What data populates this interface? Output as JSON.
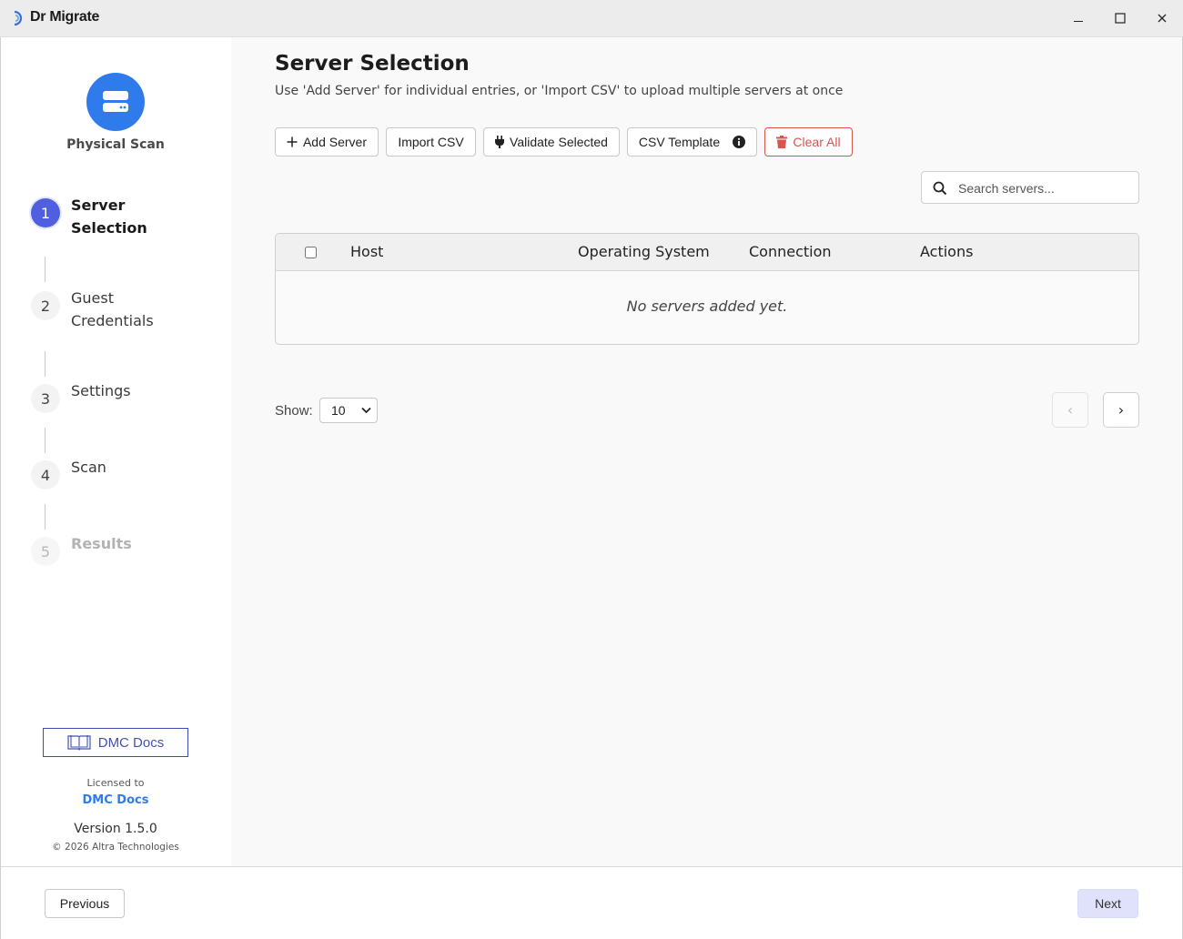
{
  "window": {
    "title": "Dr Migrate",
    "minimize_icon": "minimize-icon",
    "maximize_icon": "maximize-icon",
    "close_icon": "close-icon"
  },
  "sidebar": {
    "scan_type_label": "Physical Scan",
    "scan_icon": "server-icon",
    "accent_color": "#2f7bec",
    "steps": [
      {
        "number": "1",
        "label": "Server Selection",
        "state": "active"
      },
      {
        "number": "2",
        "label": "Guest Credentials",
        "state": "pending"
      },
      {
        "number": "3",
        "label": "Settings",
        "state": "pending"
      },
      {
        "number": "4",
        "label": "Scan",
        "state": "pending"
      },
      {
        "number": "5",
        "label": "Results",
        "state": "disabled"
      }
    ],
    "docs_button": "DMC Docs",
    "licensed_to_label": "Licensed to",
    "licensee": "DMC Docs",
    "version": "Version 1.5.0",
    "copyright": "© 2026 Altra Technologies"
  },
  "main": {
    "title": "Server Selection",
    "subtitle": "Use 'Add Server' for individual entries, or 'Import CSV' to upload multiple servers at once",
    "toolbar": {
      "add_server": "Add Server",
      "import_csv": "Import CSV",
      "validate_selected": "Validate Selected",
      "csv_template": "CSV Template",
      "clear_all": "Clear All"
    },
    "search": {
      "placeholder": "Search servers..."
    },
    "table": {
      "columns": [
        "Host",
        "Operating System",
        "Connection",
        "Actions"
      ],
      "empty_message": "No servers added yet."
    },
    "pagination": {
      "show_label": "Show:",
      "page_size": "10",
      "page_size_options": [
        "10"
      ],
      "prev": "‹",
      "next": "›"
    }
  },
  "footer": {
    "previous": "Previous",
    "next": "Next"
  },
  "colors": {
    "active_step": "#4f5fe0",
    "danger": "#d9534f",
    "next_button_bg": "#dfe2fa"
  }
}
